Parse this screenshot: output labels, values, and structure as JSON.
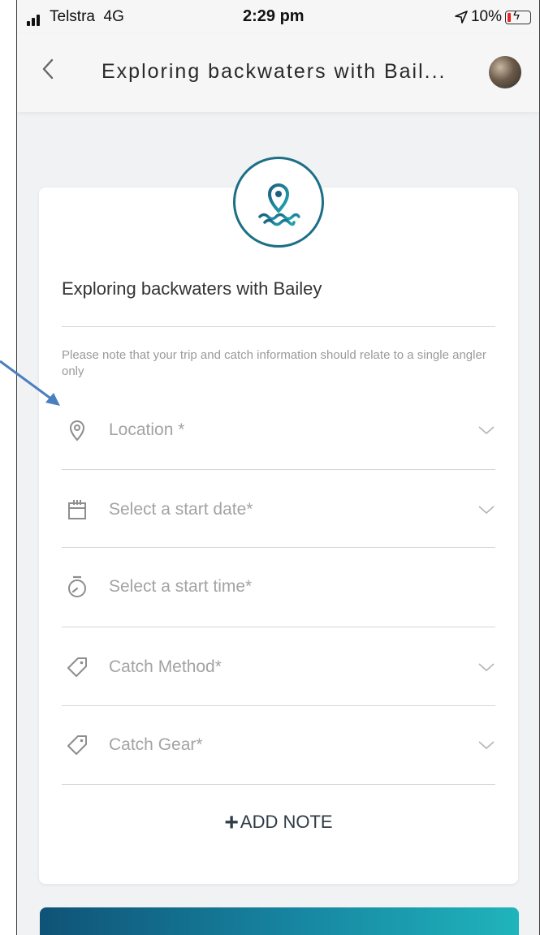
{
  "status_bar": {
    "carrier": "Telstra",
    "network": "4G",
    "time": "2:29 pm",
    "battery": "10%"
  },
  "nav": {
    "title": "Exploring backwaters with Bail...",
    "back_icon": "chevron-left-icon"
  },
  "form": {
    "trip_name": "Exploring backwaters with Bailey",
    "note": "Please note that your trip and catch information should relate to a single angler only",
    "fields": [
      {
        "label": "Location *",
        "icon": "location-pin-icon",
        "has_dropdown": true
      },
      {
        "label": "Select a start date*",
        "icon": "calendar-icon",
        "has_dropdown": true
      },
      {
        "label": "Select a start time*",
        "icon": "stopwatch-icon",
        "has_dropdown": false
      },
      {
        "label": "Catch Method*",
        "icon": "tag-icon",
        "has_dropdown": true
      },
      {
        "label": "Catch Gear*",
        "icon": "tag-icon",
        "has_dropdown": true
      }
    ],
    "add_note_plus": "+",
    "add_note_label": "ADD NOTE"
  },
  "colors": {
    "accent": "#1c6f86",
    "cta_start": "#0f5377",
    "cta_end": "#20b4bc",
    "annotation_arrow": "#4a7fbf"
  }
}
